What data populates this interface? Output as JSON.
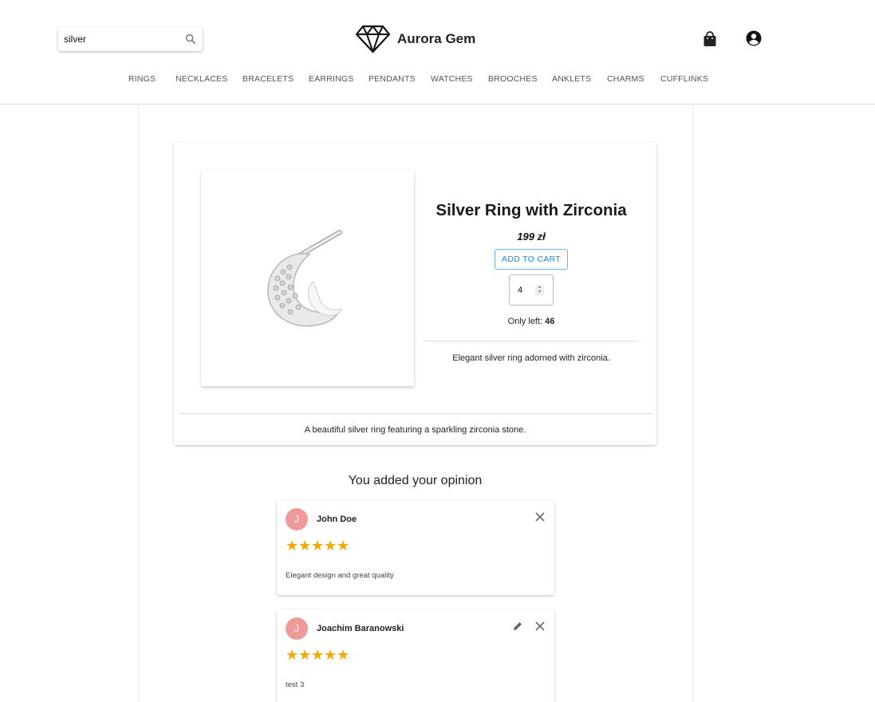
{
  "header": {
    "search": {
      "value": "silver",
      "placeholder": ""
    },
    "brand_name": "Aurora Gem",
    "nav": [
      "RINGS",
      "NECKLACES",
      "BRACELETS",
      "EARRINGS",
      "PENDANTS",
      "WATCHES",
      "BROOCHES",
      "ANKLETS",
      "CHARMS",
      "CUFFLINKS"
    ]
  },
  "product": {
    "title": "Silver Ring with Zirconia",
    "price": "199 zł",
    "add_to_cart_label": "ADD TO CART",
    "quantity": "4",
    "stock_label": "Only left:",
    "stock_value": "46",
    "short_description": "Elegant silver ring adorned with zirconia.",
    "long_description": "A beautiful silver ring featuring a sparkling zirconia stone."
  },
  "reviews": {
    "heading": "You added your opinion",
    "items": [
      {
        "avatar_letter": "J",
        "author": "John Doe",
        "rating": 5,
        "stars": "★★★★★",
        "text": "Elegant design and great quality",
        "editable": false
      },
      {
        "avatar_letter": "J",
        "author": "Joachim Baranowski",
        "rating": 5,
        "stars": "★★★★★",
        "text": "test 3",
        "editable": true
      }
    ]
  },
  "colors": {
    "accent": "#1e88e5",
    "star": "#f5a800",
    "avatar": "#ef9a9a"
  },
  "icons": {
    "search": "search-icon",
    "logo": "diamond-icon",
    "cart": "shopping-bag-icon",
    "account": "account-circle-icon",
    "edit": "pencil-icon",
    "delete": "close-icon"
  }
}
